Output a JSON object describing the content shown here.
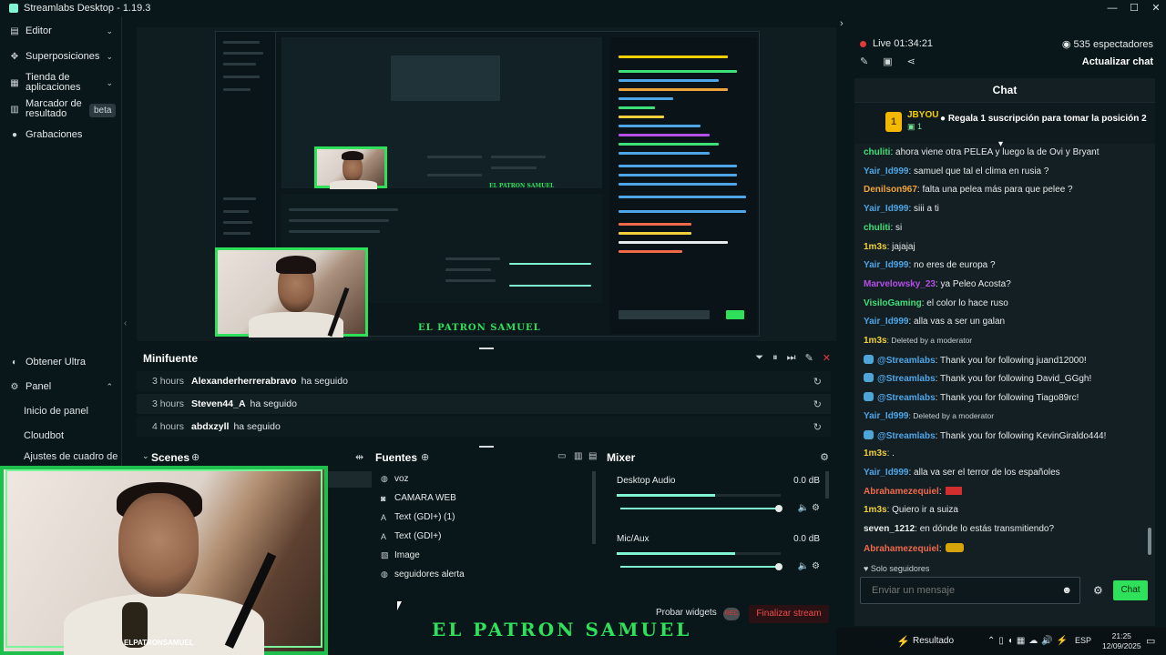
{
  "window": {
    "title": "Streamlabs Desktop - 1.19.3",
    "controls": [
      "—",
      "☐",
      "✕"
    ]
  },
  "sidebar": {
    "items": [
      {
        "label": "Editor",
        "icon": "editor-icon"
      },
      {
        "label": "Superposiciones",
        "icon": "overlay-icon"
      },
      {
        "label": "Tienda de aplicaciones",
        "icon": "store-icon"
      },
      {
        "label": "Marcador de resultado",
        "icon": "scoreboard-icon",
        "badge": "beta"
      },
      {
        "label": "Grabaciones",
        "icon": "recordings-icon"
      }
    ],
    "bottom": [
      {
        "label": "Obtener Ultra",
        "icon": "ultra-icon"
      },
      {
        "label": "Panel",
        "icon": "dashboard-icon"
      }
    ],
    "panel_sub": [
      "Inicio de panel",
      "Cloudbot",
      "Ajustes de cuadro de"
    ]
  },
  "preview": {
    "overlay_title": "EL PATRON SAMUEL"
  },
  "minifeed": {
    "title": "Minifuente",
    "rows": [
      {
        "time": "3 hours",
        "user": "Alexanderherrerabravo",
        "action": "ha seguido"
      },
      {
        "time": "3 hours",
        "user": "Steven44_A",
        "action": "ha seguido"
      },
      {
        "time": "4 hours",
        "user": "abdxzyll",
        "action": "ha seguido"
      }
    ]
  },
  "scenes": {
    "title": "Scenes"
  },
  "sources": {
    "title": "Fuentes",
    "items": [
      {
        "label": "voz",
        "icon": "globe-icon"
      },
      {
        "label": "CAMARA WEB",
        "icon": "camera-icon"
      },
      {
        "label": "Text (GDI+) (1)",
        "icon": "text-icon"
      },
      {
        "label": "Text (GDI+)",
        "icon": "text-icon"
      },
      {
        "label": "Image",
        "icon": "image-icon"
      },
      {
        "label": "seguidores alerta",
        "icon": "globe-icon"
      }
    ]
  },
  "mixer": {
    "title": "Mixer",
    "channels": [
      {
        "label": "Desktop Audio",
        "db": "0.0 dB",
        "level": 0.6
      },
      {
        "label": "Mic/Aux",
        "db": "0.0 dB",
        "level": 0.72
      }
    ]
  },
  "footer": {
    "test_widgets": "Probar widgets",
    "rec": "REC",
    "end_stream": "Finalizar stream"
  },
  "webcam": {
    "tag": "ELPATRONSAMUEL"
  },
  "chat": {
    "live": "Live 01:34:21",
    "viewers": "535 espectadores",
    "refresh": "Actualizar chat",
    "title": "Chat",
    "banner": {
      "rank": "1",
      "user": "JBYOU",
      "count": "1",
      "text": "Regala 1 suscripción para tomar la posición 2"
    },
    "messages": [
      {
        "user": "chuliti",
        "text": ": ahora viene otra PELEA y luego la de Ovi y Bryant",
        "color": "#3ee07a"
      },
      {
        "user": "Yair_Id999",
        "text": ": samuel que tal el clima en rusia ?",
        "color": "#4ea6e8"
      },
      {
        "user": "Denilson967",
        "text": ": falta una pelea más para que pelee ?",
        "color": "#f0a43a"
      },
      {
        "user": "Yair_Id999",
        "text": ": siii a ti",
        "color": "#4ea6e8"
      },
      {
        "user": "chuliti",
        "text": ": si",
        "color": "#3ee07a"
      },
      {
        "user": "1m3s",
        "text": ": jajajaj",
        "color": "#f0d03a"
      },
      {
        "user": "Yair_Id999",
        "text": ": no eres de europa ?",
        "color": "#4ea6e8"
      },
      {
        "user": "Marvelowsky_23",
        "text": ": ya Peleo Acosta?",
        "color": "#b64ee8"
      },
      {
        "user": "VisiloGaming",
        "text": ": el color lo hace ruso",
        "color": "#3ee07a"
      },
      {
        "user": "Yair_Id999",
        "text": ": alla vas a ser un galan",
        "color": "#4ea6e8"
      },
      {
        "user": "1m3s",
        "text": ": Deleted by a moderator",
        "color": "#f0d03a",
        "deleted": true
      },
      {
        "user": "@Streamlabs",
        "text": ": Thank you for following juand12000!",
        "color": "#4ea6e8",
        "bot": true
      },
      {
        "user": "@Streamlabs",
        "text": ": Thank you for following David_GGgh!",
        "color": "#4ea6e8",
        "bot": true
      },
      {
        "user": "@Streamlabs",
        "text": ": Thank you for following Tiago89rc!",
        "color": "#4ea6e8",
        "bot": true
      },
      {
        "user": "Yair_Id999",
        "text": ": Deleted by a moderator",
        "color": "#4ea6e8",
        "deleted": true
      },
      {
        "user": "@Streamlabs",
        "text": ": Thank you for following KevinGiraldo444!",
        "color": "#4ea6e8",
        "bot": true
      },
      {
        "user": "1m3s",
        "text": ": .",
        "color": "#f0d03a"
      },
      {
        "user": "Yair_Id999",
        "text": ": alla va ser el terror de los españoles",
        "color": "#4ea6e8"
      },
      {
        "user": "Abrahamezequiel",
        "text": ":",
        "color": "#f06a4a",
        "emote": "red"
      },
      {
        "user": "1m3s",
        "text": ": Quiero ir a suiza",
        "color": "#f0d03a"
      },
      {
        "user": "seven_1212",
        "text": ": en dónde lo estás transmitiendo?",
        "color": "#e6eaeb"
      },
      {
        "user": "Abrahamezequiel",
        "text": ":",
        "color": "#f06a4a",
        "emote": "car"
      }
    ],
    "solo": "Solo seguidores",
    "input_placeholder": "Enviar un mensaje",
    "send": "Chat"
  },
  "taskbar": {
    "app": "Resultado",
    "lang": "ESP",
    "time": "21:25",
    "date": "12/09/2025"
  }
}
